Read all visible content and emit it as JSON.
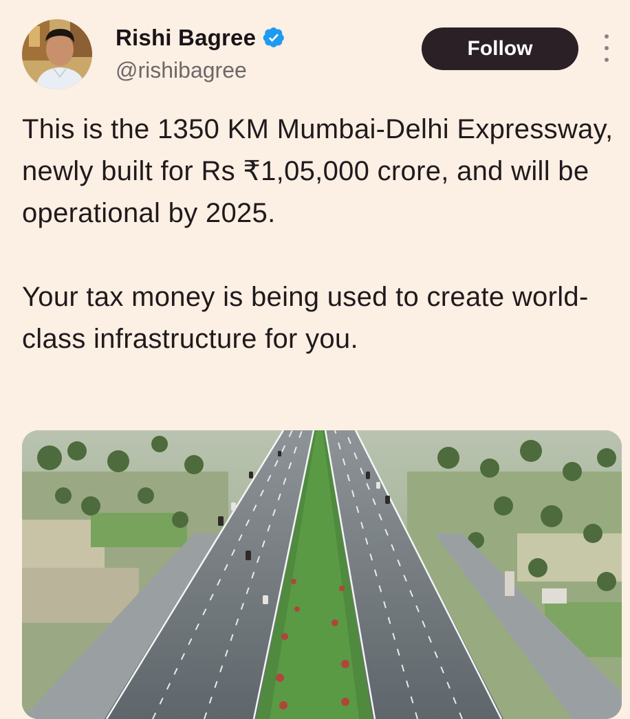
{
  "author": {
    "display_name": "Rishi Bagree",
    "handle": "@rishibagree",
    "verified": true,
    "avatar_icon": "profile-photo",
    "verified_icon": "verified-badge-icon"
  },
  "actions": {
    "follow_label": "Follow",
    "more_icon": "more-options-icon"
  },
  "tweet": {
    "paragraph_1": "This is the 1350 KM Mumbai-Delhi Expressway, newly built for Rs ₹1,05,000 crore, and will be operational by 2025.",
    "paragraph_2": "Your tax money is being used to create world-class infrastructure for you."
  },
  "media": {
    "type": "photo",
    "subject": "aerial view of an expressway"
  },
  "colors": {
    "background": "#fcefe3",
    "follow_button": "#2a2026",
    "verified_badge": "#1d9bf0",
    "handle_text": "#6e6869"
  }
}
